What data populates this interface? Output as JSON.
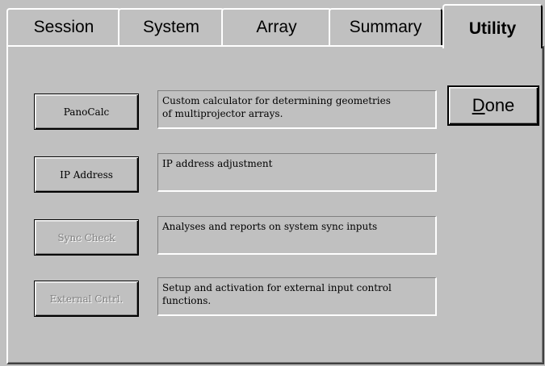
{
  "tabs": [
    {
      "label": "Session"
    },
    {
      "label": "System"
    },
    {
      "label": "Array"
    },
    {
      "label": "Summary"
    },
    {
      "label": "Utility"
    }
  ],
  "utilities": [
    {
      "button_label": "PanoCalc",
      "enabled": true,
      "description": "Custom calculator for determining geometries\nof multiprojector arrays."
    },
    {
      "button_label": "IP Address",
      "enabled": true,
      "description": "IP address adjustment"
    },
    {
      "button_label": "Sync Check",
      "enabled": false,
      "description": "Analyses and reports on system sync inputs"
    },
    {
      "button_label": "External Cntrl.",
      "enabled": false,
      "description": "Setup and activation for external input control\nfunctions."
    }
  ],
  "done": {
    "mnemonic": "D",
    "rest": "one"
  },
  "colors": {
    "face": "#c0c0c0",
    "highlight": "#ffffff",
    "shadow": "#808080",
    "dark": "#000000",
    "disabled_text": "#808080"
  }
}
